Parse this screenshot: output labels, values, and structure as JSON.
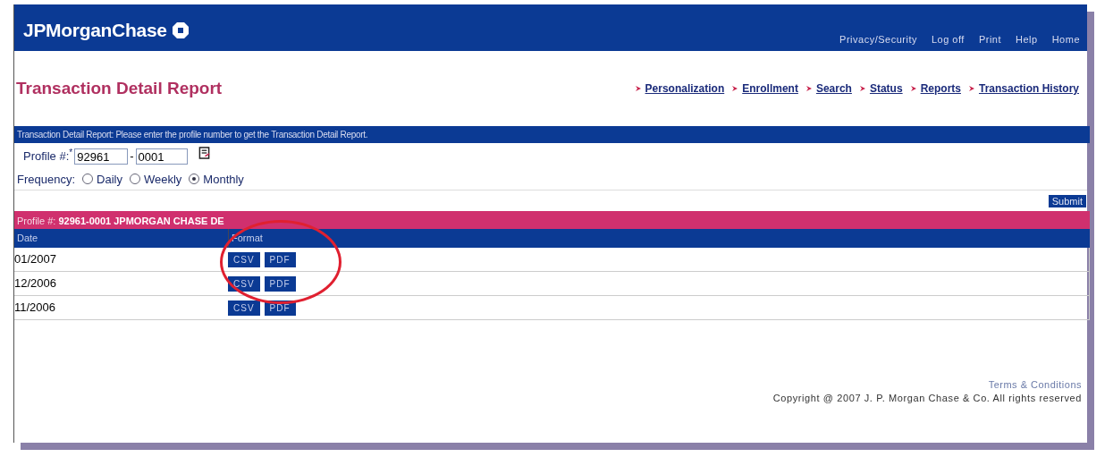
{
  "header": {
    "logo": "JPMorganChase",
    "links": [
      "Privacy/Security",
      "Log off",
      "Print",
      "Help",
      "Home"
    ]
  },
  "page_title": "Transaction Detail Report",
  "nav": [
    "Personalization",
    "Enrollment",
    "Search",
    "Status",
    "Reports",
    "Transaction History"
  ],
  "instruction": "Transaction Detail Report: Please enter the profile number to get the Transaction Detail Report.",
  "profile": {
    "label": "Profile #:",
    "required_mark": "*",
    "part1": "92961",
    "separator": "-",
    "part2": "0001"
  },
  "frequency": {
    "label": "Frequency:",
    "options": [
      {
        "label": "Daily",
        "selected": false
      },
      {
        "label": "Weekly",
        "selected": false
      },
      {
        "label": "Monthly",
        "selected": true
      }
    ]
  },
  "submit": "Submit",
  "report": {
    "profile_label": "Profile #:",
    "profile_value": "92961-0001  JPMORGAN CHASE DE",
    "columns": [
      "Date",
      "Format"
    ],
    "rows": [
      {
        "date": "01/2007",
        "formats": [
          "CSV",
          "PDF"
        ]
      },
      {
        "date": "12/2006",
        "formats": [
          "CSV",
          "PDF"
        ]
      },
      {
        "date": "11/2006",
        "formats": [
          "CSV",
          "PDF"
        ]
      }
    ]
  },
  "annotations": [
    {
      "kind": "ellipse"
    }
  ],
  "footer": {
    "terms": "Terms & Conditions",
    "copyright": "Copyright @ 2007 J. P. Morgan Chase & Co. All rights reserved"
  }
}
